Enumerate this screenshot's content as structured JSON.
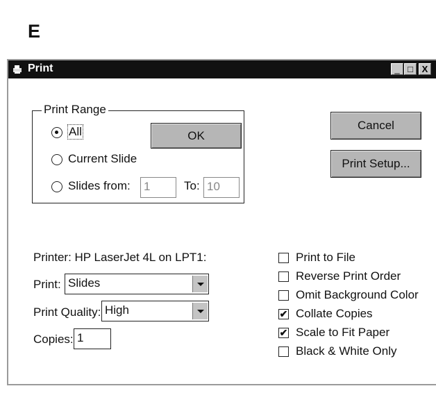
{
  "figure_label": "E",
  "window": {
    "title": "Print",
    "minimize": "_",
    "maximize": "□",
    "close": "X"
  },
  "print_range": {
    "legend": "Print Range",
    "all_label": "All",
    "current_slide_label": "Current Slide",
    "slides_from_label": "Slides from:",
    "from_value": "1",
    "to_label": "To:",
    "to_value": "10",
    "selected": "all"
  },
  "buttons": {
    "ok": "OK",
    "cancel": "Cancel",
    "print_setup": "Print Setup..."
  },
  "printer": {
    "label": "Printer: HP LaserJet 4L on LPT1:"
  },
  "print_what": {
    "label": "Print:",
    "value": "Slides"
  },
  "print_quality": {
    "label": "Print Quality:",
    "value": "High"
  },
  "copies": {
    "label": "Copies:",
    "value": "1"
  },
  "options": [
    {
      "label": "Print to File",
      "checked": false
    },
    {
      "label": "Reverse Print Order",
      "checked": false
    },
    {
      "label": "Omit Background Color",
      "checked": false
    },
    {
      "label": "Collate Copies",
      "checked": true
    },
    {
      "label": "Scale to Fit Paper",
      "checked": true
    },
    {
      "label": "Black & White Only",
      "checked": false
    }
  ]
}
